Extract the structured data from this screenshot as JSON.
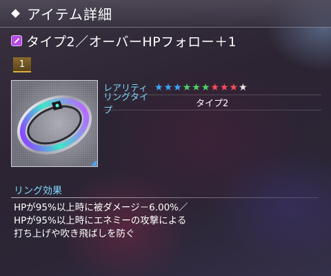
{
  "header": {
    "title": "アイテム詳細"
  },
  "item": {
    "name": "タイプ2／オーバーHPフォロー＋1",
    "icon": "ring-type-icon",
    "count": "1"
  },
  "stats": {
    "rarity_label": "レアリティ",
    "rarity_stars": [
      {
        "color": "#3fa8ff"
      },
      {
        "color": "#3fa8ff"
      },
      {
        "color": "#3fa8ff"
      },
      {
        "color": "#4cd66a"
      },
      {
        "color": "#4cd66a"
      },
      {
        "color": "#4cd66a"
      },
      {
        "color": "#ff4d5a"
      },
      {
        "color": "#ff4d5a"
      },
      {
        "color": "#ff4d5a"
      },
      {
        "color": "#e8e8e8"
      }
    ],
    "ring_type_label": "リングタイプ",
    "ring_type_value": "タイプ2"
  },
  "effect": {
    "title": "リング効果",
    "text": "HPが95%以上時に被ダメージ－6.00%／\nHPが95%以上時にエネミーの攻撃による\n打ち上げや吹き飛ばしを防ぐ"
  }
}
